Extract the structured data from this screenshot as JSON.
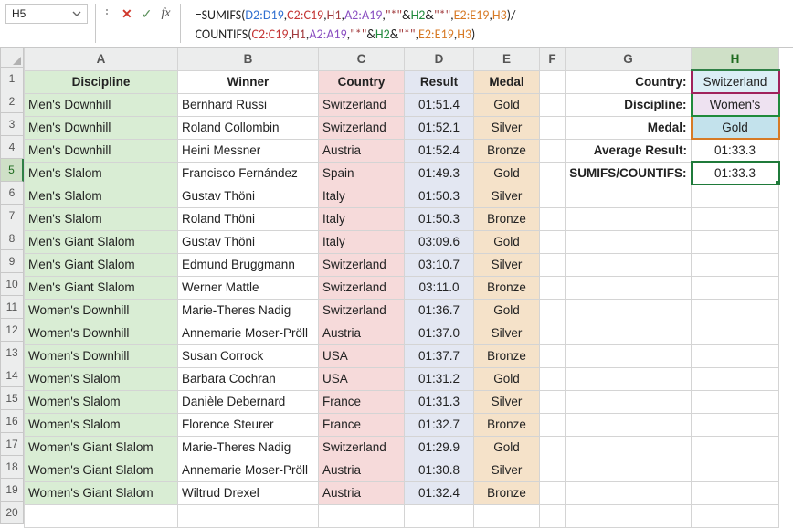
{
  "nameBox": {
    "ref": "H5"
  },
  "formula": {
    "lines": [
      [
        {
          "t": "=",
          "c": "c-plain"
        },
        {
          "t": "SUMIFS",
          "c": "c-func"
        },
        {
          "t": "(",
          "c": "c-plain"
        },
        {
          "t": "D2:D19",
          "c": "c-blue"
        },
        {
          "t": ",",
          "c": "c-plain"
        },
        {
          "t": "C2:C19",
          "c": "c-red"
        },
        {
          "t": ",",
          "c": "c-plain"
        },
        {
          "t": "H1",
          "c": "c-mar"
        },
        {
          "t": ",",
          "c": "c-plain"
        },
        {
          "t": "A2:A19",
          "c": "c-purp"
        },
        {
          "t": ",",
          "c": "c-plain"
        },
        {
          "t": "\"*\"",
          "c": "c-mar"
        },
        {
          "t": "&",
          "c": "c-plain"
        },
        {
          "t": "H2",
          "c": "c-green"
        },
        {
          "t": "&",
          "c": "c-plain"
        },
        {
          "t": "\"*\"",
          "c": "c-mar"
        },
        {
          "t": ",",
          "c": "c-plain"
        },
        {
          "t": "E2:E19",
          "c": "c-orange"
        },
        {
          "t": ",",
          "c": "c-plain"
        },
        {
          "t": "H3",
          "c": "c-orange"
        },
        {
          "t": ")/",
          "c": "c-plain"
        }
      ],
      [
        {
          "t": "COUNTIFS",
          "c": "c-func"
        },
        {
          "t": "(",
          "c": "c-plain"
        },
        {
          "t": "C2:C19",
          "c": "c-red"
        },
        {
          "t": ",",
          "c": "c-plain"
        },
        {
          "t": "H1",
          "c": "c-mar"
        },
        {
          "t": ",",
          "c": "c-plain"
        },
        {
          "t": "A2:A19",
          "c": "c-purp"
        },
        {
          "t": ",",
          "c": "c-plain"
        },
        {
          "t": "\"*\"",
          "c": "c-mar"
        },
        {
          "t": "&",
          "c": "c-plain"
        },
        {
          "t": "H2",
          "c": "c-green"
        },
        {
          "t": "&",
          "c": "c-plain"
        },
        {
          "t": "\"*\"",
          "c": "c-mar"
        },
        {
          "t": ",",
          "c": "c-plain"
        },
        {
          "t": "E2:E19",
          "c": "c-orange"
        },
        {
          "t": ",",
          "c": "c-plain"
        },
        {
          "t": "H3",
          "c": "c-orange"
        },
        {
          "t": ")",
          "c": "c-plain"
        }
      ]
    ]
  },
  "icons": {
    "cancel": "✕",
    "enter": "✓",
    "fx": "fx"
  },
  "columns": [
    "A",
    "B",
    "C",
    "D",
    "E",
    "F",
    "G",
    "H"
  ],
  "headers": {
    "A": "Discipline",
    "B": "Winner",
    "C": "Country",
    "D": "Result",
    "E": "Medal"
  },
  "rows": [
    {
      "A": "Men's Downhill",
      "B": "Bernhard Russi",
      "C": "Switzerland",
      "D": "01:51.4",
      "E": "Gold"
    },
    {
      "A": "Men's Downhill",
      "B": "Roland Collombin",
      "C": "Switzerland",
      "D": "01:52.1",
      "E": "Silver"
    },
    {
      "A": "Men's Downhill",
      "B": "Heini Messner",
      "C": "Austria",
      "D": "01:52.4",
      "E": "Bronze"
    },
    {
      "A": "Men's Slalom",
      "B": "Francisco Fernández",
      "C": "Spain",
      "D": "01:49.3",
      "E": "Gold"
    },
    {
      "A": "Men's Slalom",
      "B": "Gustav Thöni",
      "C": "Italy",
      "D": "01:50.3",
      "E": "Silver"
    },
    {
      "A": "Men's Slalom",
      "B": "Roland Thöni",
      "C": "Italy",
      "D": "01:50.3",
      "E": "Bronze"
    },
    {
      "A": "Men's Giant Slalom",
      "B": "Gustav Thöni",
      "C": "Italy",
      "D": "03:09.6",
      "E": "Gold"
    },
    {
      "A": "Men's Giant Slalom",
      "B": "Edmund Bruggmann",
      "C": "Switzerland",
      "D": "03:10.7",
      "E": "Silver"
    },
    {
      "A": "Men's Giant Slalom",
      "B": "Werner Mattle",
      "C": "Switzerland",
      "D": "03:11.0",
      "E": "Bronze"
    },
    {
      "A": "Women's Downhill",
      "B": "Marie-Theres Nadig",
      "C": "Switzerland",
      "D": "01:36.7",
      "E": "Gold"
    },
    {
      "A": "Women's Downhill",
      "B": "Annemarie Moser-Pröll",
      "C": "Austria",
      "D": "01:37.0",
      "E": "Silver"
    },
    {
      "A": "Women's Downhill",
      "B": "Susan Corrock",
      "C": "USA",
      "D": "01:37.7",
      "E": "Bronze"
    },
    {
      "A": "Women's Slalom",
      "B": "Barbara Cochran",
      "C": "USA",
      "D": "01:31.2",
      "E": "Gold"
    },
    {
      "A": "Women's Slalom",
      "B": "Danièle Debernard",
      "C": "France",
      "D": "01:31.3",
      "E": "Silver"
    },
    {
      "A": "Women's Slalom",
      "B": "Florence Steurer",
      "C": "France",
      "D": "01:32.7",
      "E": "Bronze"
    },
    {
      "A": "Women's Giant Slalom",
      "B": "Marie-Theres Nadig",
      "C": "Switzerland",
      "D": "01:29.9",
      "E": "Gold"
    },
    {
      "A": "Women's Giant Slalom",
      "B": "Annemarie Moser-Pröll",
      "C": "Austria",
      "D": "01:30.8",
      "E": "Silver"
    },
    {
      "A": "Women's Giant Slalom",
      "B": "Wiltrud Drexel",
      "C": "Austria",
      "D": "01:32.4",
      "E": "Bronze"
    }
  ],
  "side": {
    "labels": {
      "country": "Country:",
      "discipline": "Discipline:",
      "medal": "Medal:",
      "avg": "Average Result:",
      "sc": "SUMIFS/COUNTIFS:"
    },
    "values": {
      "country": "Switzerland",
      "discipline": "Women's",
      "medal": "Gold",
      "avg": "01:33.3",
      "sc": "01:33.3"
    }
  }
}
